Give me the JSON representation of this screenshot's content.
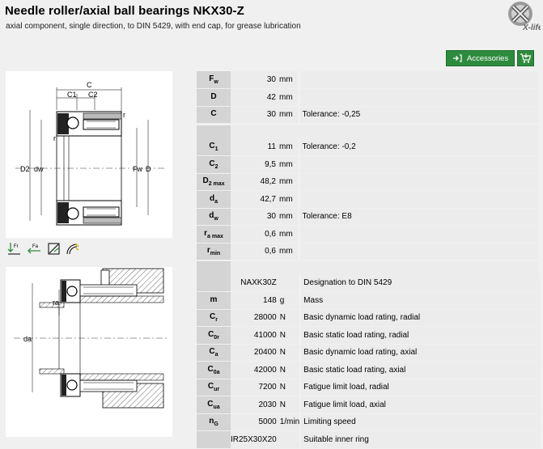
{
  "header": {
    "title": "Needle roller/axial ball bearings NKX30-Z",
    "subtitle": "axial component, single direction, to DIN 5429, with end cap, for grease lubrication",
    "logo_text": "X-life"
  },
  "toolbar": {
    "accessories_label": "Accessories",
    "accent": "#2e8b3e"
  },
  "drawing_top": {
    "labels": [
      "C",
      "C1",
      "C2",
      "r",
      "r",
      "D2",
      "dw",
      "Fw",
      "D"
    ]
  },
  "drawing_bottom": {
    "labels": [
      "ra",
      "da"
    ]
  },
  "icons": [
    "radial-load-icon",
    "axial-load-icon",
    "sealed-icon",
    "grease-icon"
  ],
  "table1": [
    {
      "sym": "F",
      "sub": "w",
      "val": "30",
      "unit": "mm",
      "desc": ""
    },
    {
      "sym": "D",
      "sub": "",
      "val": "42",
      "unit": "mm",
      "desc": ""
    },
    {
      "sym": "C",
      "sub": "",
      "val": "30",
      "unit": "mm",
      "desc": "Tolerance: -0,25"
    }
  ],
  "table2": [
    {
      "sym": "C",
      "sub": "1",
      "val": "11",
      "unit": "mm",
      "desc": "Tolerance: -0,2"
    },
    {
      "sym": "C",
      "sub": "2",
      "val": "9,5",
      "unit": "mm",
      "desc": ""
    },
    {
      "sym": "D",
      "sub": "2 max",
      "val": "48,2",
      "unit": "mm",
      "desc": ""
    },
    {
      "sym": "d",
      "sub": "a",
      "val": "42,7",
      "unit": "mm",
      "desc": ""
    },
    {
      "sym": "d",
      "sub": "w",
      "val": "30",
      "unit": "mm",
      "desc": "Tolerance: E8"
    },
    {
      "sym": "r",
      "sub": "a max",
      "val": "0,6",
      "unit": "mm",
      "desc": ""
    },
    {
      "sym": "r",
      "sub": "min",
      "val": "0,6",
      "unit": "mm",
      "desc": ""
    }
  ],
  "table3": [
    {
      "sym": "",
      "sub": "",
      "val": "NAXK30Z",
      "unit": "",
      "desc": "Designation to DIN 5429"
    },
    {
      "sym": "m",
      "sub": "",
      "val": "148",
      "unit": "g",
      "desc": "Mass"
    },
    {
      "sym": "C",
      "sub": "r",
      "val": "28000",
      "unit": "N",
      "desc": "Basic dynamic load rating, radial"
    },
    {
      "sym": "C",
      "sub": "0r",
      "val": "41000",
      "unit": "N",
      "desc": "Basic static load rating, radial"
    },
    {
      "sym": "C",
      "sub": "a",
      "val": "20400",
      "unit": "N",
      "desc": "Basic dynamic load rating, axial"
    },
    {
      "sym": "C",
      "sub": "0a",
      "val": "42000",
      "unit": "N",
      "desc": "Basic static load rating, axial"
    },
    {
      "sym": "C",
      "sub": "ur",
      "val": "7200",
      "unit": "N",
      "desc": "Fatigue limit load, radial"
    },
    {
      "sym": "C",
      "sub": "ua",
      "val": "2030",
      "unit": "N",
      "desc": "Fatigue limit load, axial"
    },
    {
      "sym": "n",
      "sub": "G",
      "val": "5000",
      "unit": "1/min",
      "desc": "Limiting speed"
    },
    {
      "sym": "",
      "sub": "",
      "val": "IR25X30X20",
      "unit": "",
      "desc": "Suitable inner ring"
    }
  ]
}
